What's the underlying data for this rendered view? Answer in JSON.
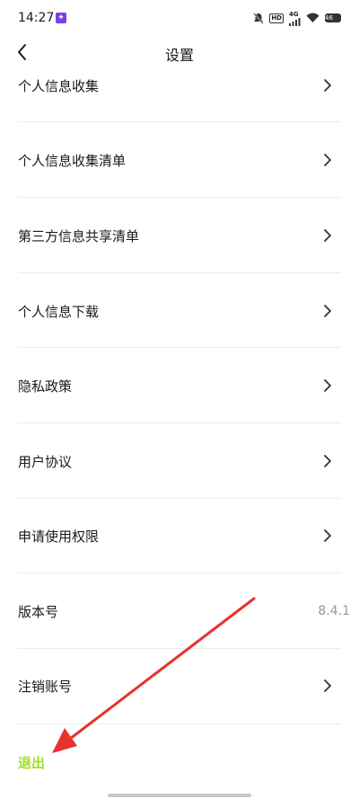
{
  "status": {
    "time": "14:27",
    "hd": "HD",
    "network": "4G",
    "battery": "46"
  },
  "header": {
    "title": "设置"
  },
  "items": [
    {
      "label": "个人信息收集",
      "chevron": true
    },
    {
      "label": "个人信息收集清单",
      "chevron": true
    },
    {
      "label": "第三方信息共享清单",
      "chevron": true
    },
    {
      "label": "个人信息下载",
      "chevron": true
    },
    {
      "label": "隐私政策",
      "chevron": true
    },
    {
      "label": "用户协议",
      "chevron": true
    },
    {
      "label": "申请使用权限",
      "chevron": true
    },
    {
      "label": "版本号",
      "value": "8.4.1",
      "chevron": false
    },
    {
      "label": "注销账号",
      "chevron": true
    }
  ],
  "logout": {
    "label": "退出",
    "color": "#9fe11a"
  },
  "annotation": {
    "color": "#e8322b"
  }
}
